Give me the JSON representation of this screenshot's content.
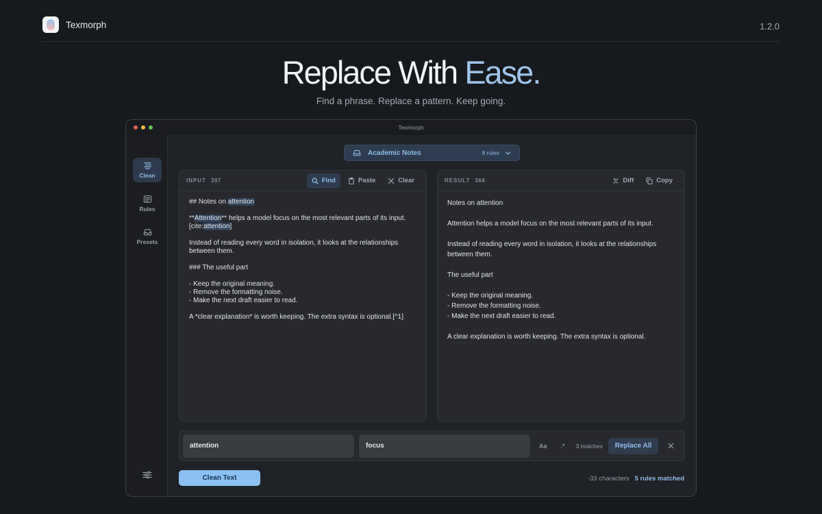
{
  "site": {
    "brand_name": "Texmorph",
    "version": "1.2.0"
  },
  "hero": {
    "title_main": "Replace With ",
    "title_accent": "Ease.",
    "subtitle": "Find a phrase. Replace a pattern. Keep going."
  },
  "window": {
    "title": "Texmorph"
  },
  "sidebar": {
    "items": [
      {
        "label": "Clean",
        "icon": "clean-icon",
        "active": true
      },
      {
        "label": "Rules",
        "icon": "rules-icon",
        "active": false
      },
      {
        "label": "Presets",
        "icon": "presets-icon",
        "active": false
      }
    ],
    "settings_icon": "sliders-icon"
  },
  "preset": {
    "name": "Academic Notes",
    "count": "8 rules"
  },
  "input_panel": {
    "label": "INPUT",
    "count": "397",
    "actions": {
      "find": "Find",
      "paste": "Paste",
      "clear": "Clear"
    }
  },
  "result_panel": {
    "label": "RESULT",
    "count": "364",
    "actions": {
      "diff": "Diff",
      "copy": "Copy"
    },
    "lines": [
      "Notes on attention",
      "Attention helps a model focus on the most relevant parts of its input.",
      "Instead of reading every word in isolation, it looks at the relationships between them.",
      "The useful part",
      "- Keep the original meaning.",
      "- Remove the formatting noise.",
      "- Make the next draft easier to read.",
      "A clear explanation is worth keeping. The extra syntax is optional."
    ]
  },
  "find_bar": {
    "find_value": "attention",
    "replace_value": "focus",
    "case_option": "Aa",
    "regex_option": ".*",
    "matches": "3 matches",
    "replace_all": "Replace All"
  },
  "footer": {
    "clean_button": "Clean Text",
    "char_delta": "-33 characters",
    "rules_matched": "5 rules matched"
  },
  "colors": {
    "accent": "#8fbde9",
    "primary_button": "#8cc0f2",
    "highlight": "#2f4158"
  }
}
